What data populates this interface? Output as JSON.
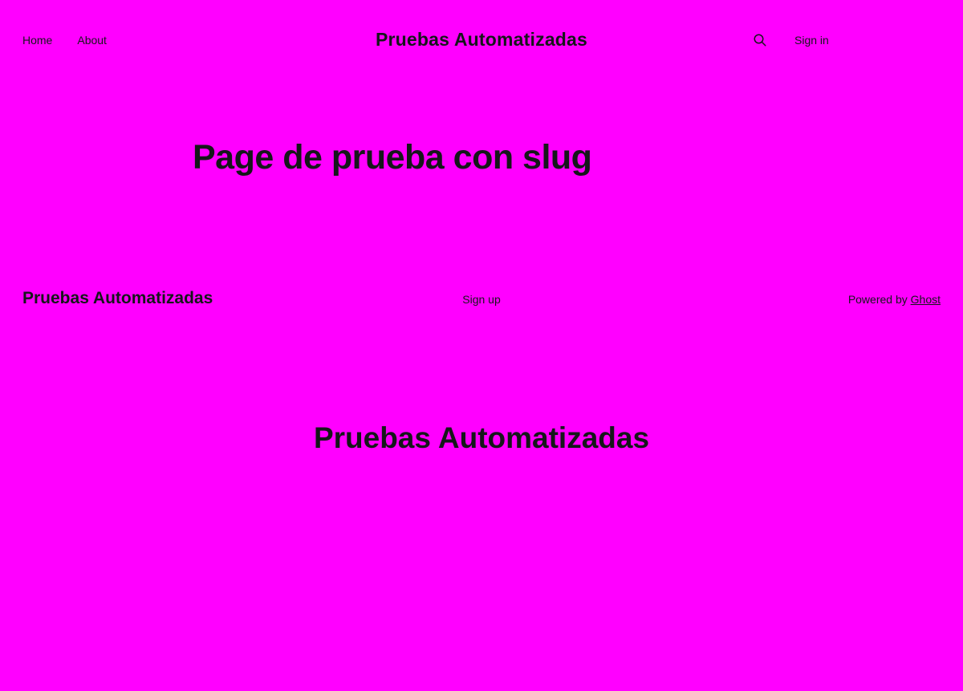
{
  "header": {
    "nav": [
      {
        "label": "Home"
      },
      {
        "label": "About"
      }
    ],
    "brand": "Pruebas Automatizadas",
    "search_icon": "search-icon",
    "signin_label": "Sign in"
  },
  "main": {
    "title": "Page de prueba con slug"
  },
  "footer": {
    "brand": "Pruebas Automatizadas",
    "signup_label": "Sign up",
    "powered_prefix": "Powered by",
    "powered_link": "Ghost"
  },
  "below_footer": {
    "brand": "Pruebas Automatizadas"
  },
  "colors": {
    "background": "#ff00ff",
    "text": "#15171a"
  }
}
